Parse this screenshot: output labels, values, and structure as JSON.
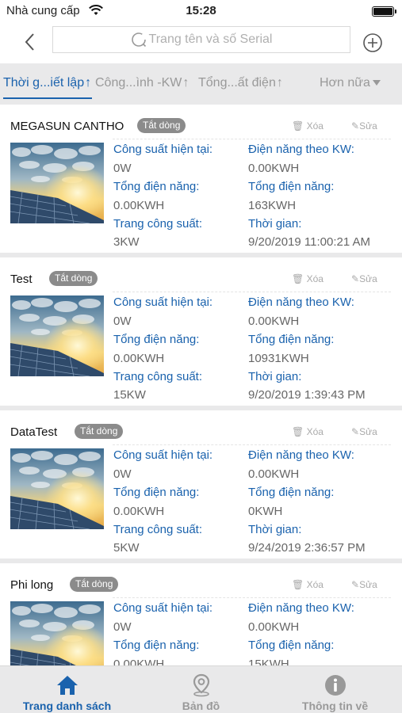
{
  "status": {
    "carrier": "Nhà cung cấp",
    "time": "15:28"
  },
  "nav": {
    "search_placeholder": "Trang tên và số Serial"
  },
  "sort": {
    "items": [
      "Thời g...iết lập",
      "Công...ình -KW",
      "Tổng...ất điện"
    ],
    "more": "Hơn nữa"
  },
  "card_labels": {
    "current_power": "Công suất hiện tại:",
    "energy_kw": "Điện năng theo KW:",
    "total_energy": "Tổng điện năng:",
    "plant_power": "Trang công suất:",
    "time": "Thời gian:",
    "delete": "Xóa",
    "edit": "Sửa"
  },
  "plants": [
    {
      "name": "MEGASUN CANTHO",
      "status": "Tắt dòng",
      "current_power": "0W",
      "energy_kw": "0.00KWH",
      "total_energy": "0.00KWH",
      "total_energy_2": "163KWH",
      "plant_power": "3KW",
      "time": "9/20/2019 11:00:21 AM"
    },
    {
      "name": "Test",
      "status": "Tắt dòng",
      "current_power": "0W",
      "energy_kw": "0.00KWH",
      "total_energy": "0.00KWH",
      "total_energy_2": "10931KWH",
      "plant_power": "15KW",
      "time": "9/20/2019 1:39:43 PM"
    },
    {
      "name": "DataTest",
      "status": "Tắt dòng",
      "current_power": "0W",
      "energy_kw": "0.00KWH",
      "total_energy": "0.00KWH",
      "total_energy_2": "0KWH",
      "plant_power": "5KW",
      "time": "9/24/2019 2:36:57 PM"
    },
    {
      "name": "Phi long",
      "status": "Tắt dòng",
      "current_power": "0W",
      "energy_kw": "0.00KWH",
      "total_energy": "0.00KWH",
      "total_energy_2": "15KWH",
      "plant_power": "",
      "time": ""
    }
  ],
  "tabs": [
    {
      "label": "Trang danh sách",
      "icon": "home-icon",
      "active": true
    },
    {
      "label": "Bản đồ",
      "icon": "map-pin-icon",
      "active": false
    },
    {
      "label": "Thông tin về",
      "icon": "info-icon",
      "active": false
    }
  ],
  "colors": {
    "accent": "#1a62ad",
    "badge": "#8b8b8b",
    "muted": "#999999"
  }
}
